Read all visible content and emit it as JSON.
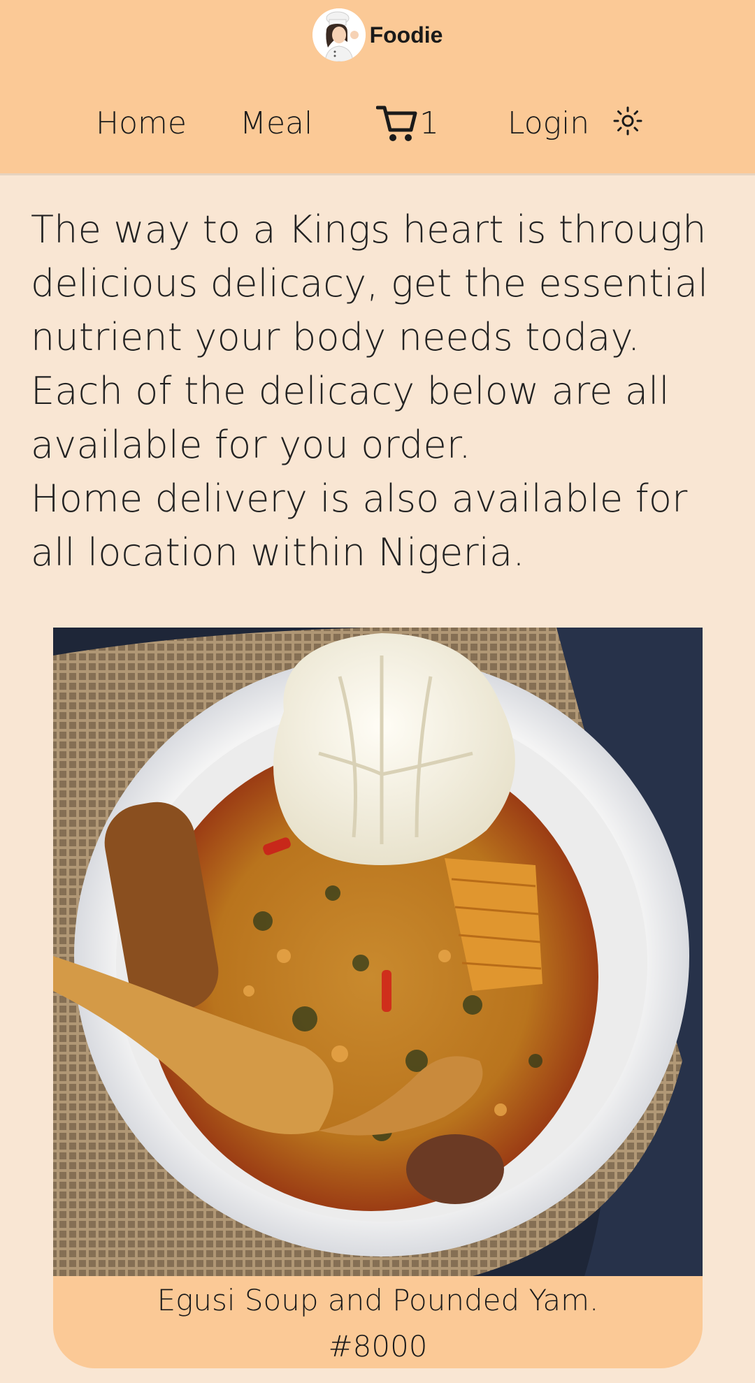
{
  "brand": {
    "name": "Foodie",
    "logo_icon": "chef-avatar-icon"
  },
  "nav": {
    "home": "Home",
    "meal": "Meal",
    "cart_count": "1",
    "cart_icon": "shopping-cart-icon",
    "login": "Login",
    "theme_icon": "sun-icon"
  },
  "intro": {
    "line1": "The way to a Kings heart is through delicious delicacy, get the essential nutrient your body needs today.",
    "line2": "Each of the delicacy below are all available for you order.",
    "line3": "Home delivery is also available for all location within Nigeria."
  },
  "meal": {
    "name": "Egusi Soup and Pounded Yam.",
    "price": "#8000"
  },
  "colors": {
    "header_bg": "#fbc996",
    "page_bg": "#f9e6d3",
    "card_footer_bg": "#fbc996"
  }
}
